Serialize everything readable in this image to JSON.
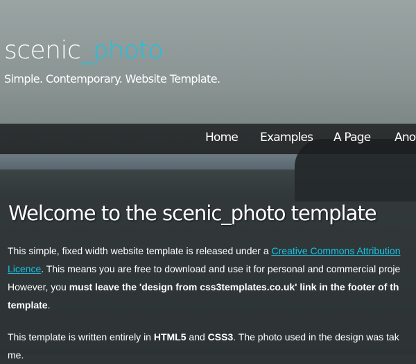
{
  "header": {
    "logo_main": "scenic",
    "logo_accent": "_photo",
    "slogan": "Simple. Contemporary. Website Template."
  },
  "nav": {
    "items": [
      {
        "label": "Home"
      },
      {
        "label": "Examples"
      },
      {
        "label": "A Page"
      },
      {
        "label": "Anot"
      }
    ]
  },
  "content": {
    "title": "Welcome to the scenic_photo template",
    "p1": {
      "text_before_link": "This simple, fixed width website template is released under a ",
      "link1": "Creative Commons Attribution",
      "link2": "Licence",
      "text_after_link": ". This means you are free to download and use it for personal and commercial proje",
      "line3_start": "However, you ",
      "bold": "must leave the 'design from css3templates.co.uk' link in the footer of th",
      "bold2": "template",
      "end": "."
    },
    "p2": {
      "start": "This template is written entirely in ",
      "html5": "HTML5",
      "and": " and ",
      "css3": "CSS3",
      "rest": ". The photo used in the design was tak",
      "line2": "me."
    }
  },
  "colors": {
    "accent": "#16c4e6",
    "nav_bg": "#1c1e20",
    "text": "#ffffff"
  }
}
